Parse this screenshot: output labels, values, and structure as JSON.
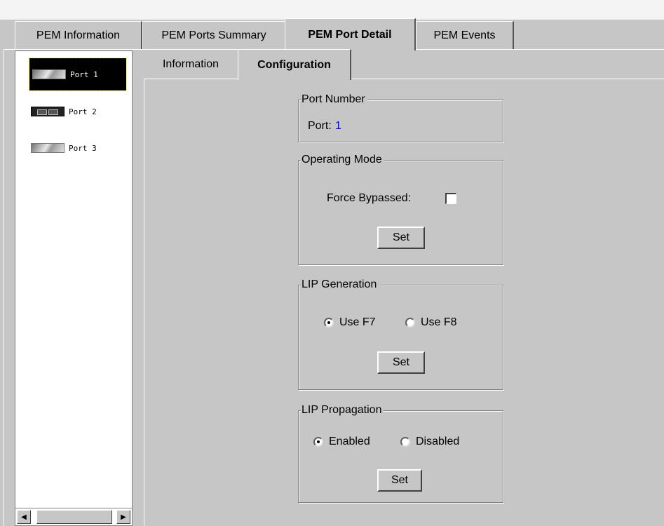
{
  "outer_tabs": [
    {
      "label": "PEM Information",
      "active": false
    },
    {
      "label": "PEM Ports Summary",
      "active": false
    },
    {
      "label": "PEM Port Detail",
      "active": true
    },
    {
      "label": "PEM Events",
      "active": false
    }
  ],
  "inner_tabs": [
    {
      "label": "Information",
      "active": false
    },
    {
      "label": "Configuration",
      "active": true
    }
  ],
  "ports": [
    {
      "label": "Port 1",
      "icon": "port-light-icon",
      "selected": true
    },
    {
      "label": "Port 2",
      "icon": "port-dark-icon",
      "selected": false
    },
    {
      "label": "Port 3",
      "icon": "port-light-icon",
      "selected": false
    }
  ],
  "port_number": {
    "title": "Port Number",
    "label": "Port:",
    "value": "1",
    "value_color": "#0000ff"
  },
  "operating_mode": {
    "title": "Operating Mode",
    "force_bypassed_label": "Force Bypassed:",
    "force_bypassed_checked": false,
    "set_label": "Set"
  },
  "lip_generation": {
    "title": "LIP Generation",
    "option1": "Use F7",
    "option2": "Use F8",
    "selected": "Use F7",
    "set_label": "Set"
  },
  "lip_propagation": {
    "title": "LIP Propagation",
    "option1": "Enabled",
    "option2": "Disabled",
    "selected": "Enabled",
    "set_label": "Set"
  },
  "scrollbar": {
    "left_arrow": "◀",
    "right_arrow": "▶"
  }
}
